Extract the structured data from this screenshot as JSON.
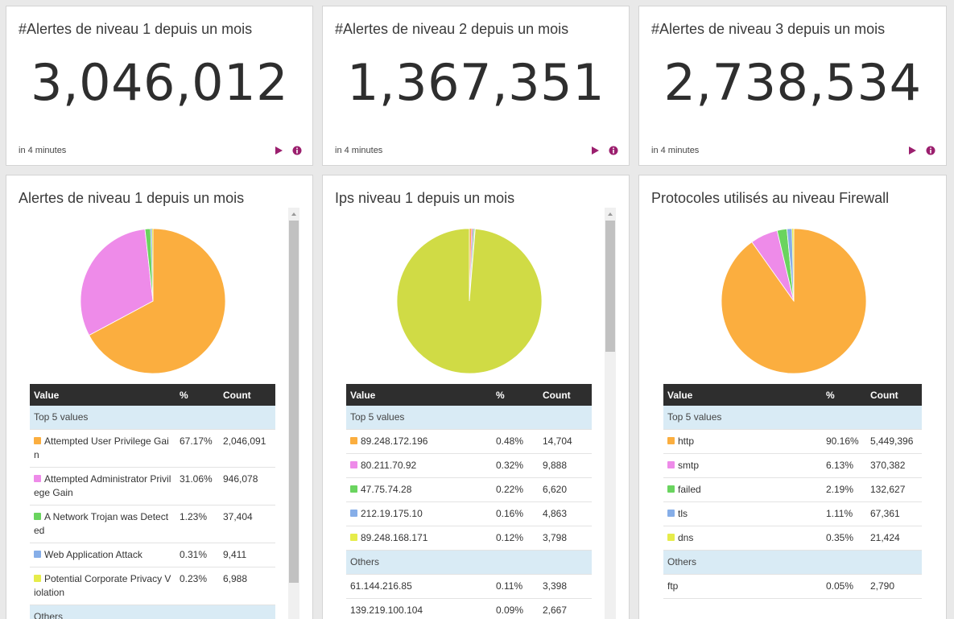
{
  "stat_cards": [
    {
      "title": "#Alertes de niveau 1 depuis un mois",
      "value": "3,046,012",
      "footer": "in 4 minutes"
    },
    {
      "title": "#Alertes de niveau 2 depuis un mois",
      "value": "1,367,351",
      "footer": "in 4 minutes"
    },
    {
      "title": "#Alertes de niveau 3 depuis un mois",
      "value": "2,738,534",
      "footer": "in 4 minutes"
    }
  ],
  "icons": {
    "play": "play-icon",
    "info": "info-icon"
  },
  "colors": {
    "accent": "#9b1f6e",
    "orange": "#fbae3f",
    "pink": "#ee8be9",
    "green": "#6ad45f",
    "blue": "#86aee8",
    "yellow": "#e6ec4a",
    "olive": "#d0db45"
  },
  "table_headers": {
    "value": "Value",
    "percent": "%",
    "count": "Count"
  },
  "groups": {
    "top": "Top 5 values",
    "others": "Others"
  },
  "panels": [
    {
      "title": "Alertes de niveau 1 depuis un mois",
      "top_rows": [
        {
          "value": "Attempted User Privilege Gain",
          "percent": "67.17%",
          "count": "2,046,091",
          "color": "#fbae3f"
        },
        {
          "value": "Attempted Administrator Privilege Gain",
          "percent": "31.06%",
          "count": "946,078",
          "color": "#ee8be9"
        },
        {
          "value": "A Network Trojan was Detected",
          "percent": "1.23%",
          "count": "37,404",
          "color": "#6ad45f"
        },
        {
          "value": "Web Application Attack",
          "percent": "0.31%",
          "count": "9,411",
          "color": "#86aee8"
        },
        {
          "value": "Potential Corporate Privacy Violation",
          "percent": "0.23%",
          "count": "6,988",
          "color": "#e6ec4a"
        }
      ],
      "other_rows": []
    },
    {
      "title": "Ips niveau 1 depuis un mois",
      "top_rows": [
        {
          "value": "89.248.172.196",
          "percent": "0.48%",
          "count": "14,704",
          "color": "#fbae3f"
        },
        {
          "value": "80.211.70.92",
          "percent": "0.32%",
          "count": "9,888",
          "color": "#ee8be9"
        },
        {
          "value": "47.75.74.28",
          "percent": "0.22%",
          "count": "6,620",
          "color": "#6ad45f"
        },
        {
          "value": "212.19.175.10",
          "percent": "0.16%",
          "count": "4,863",
          "color": "#86aee8"
        },
        {
          "value": "89.248.168.171",
          "percent": "0.12%",
          "count": "3,798",
          "color": "#e6ec4a"
        }
      ],
      "other_rows": [
        {
          "value": "61.144.216.85",
          "percent": "0.11%",
          "count": "3,398"
        },
        {
          "value": "139.219.100.104",
          "percent": "0.09%",
          "count": "2,667"
        }
      ]
    },
    {
      "title": "Protocoles utilisés au niveau Firewall",
      "top_rows": [
        {
          "value": "http",
          "percent": "90.16%",
          "count": "5,449,396",
          "color": "#fbae3f"
        },
        {
          "value": "smtp",
          "percent": "6.13%",
          "count": "370,382",
          "color": "#ee8be9"
        },
        {
          "value": "failed",
          "percent": "2.19%",
          "count": "132,627",
          "color": "#6ad45f"
        },
        {
          "value": "tls",
          "percent": "1.11%",
          "count": "67,361",
          "color": "#86aee8"
        },
        {
          "value": "dns",
          "percent": "0.35%",
          "count": "21,424",
          "color": "#e6ec4a"
        }
      ],
      "other_rows": [
        {
          "value": "ftp",
          "percent": "0.05%",
          "count": "2,790"
        }
      ]
    }
  ],
  "chart_data": [
    {
      "type": "pie",
      "labels": [
        "Attempted User Privilege Gain",
        "Attempted Administrator Privilege Gain",
        "A Network Trojan was Detected",
        "Web Application Attack",
        "Potential Corporate Privacy Violation"
      ],
      "values": [
        67.17,
        31.06,
        1.23,
        0.31,
        0.23
      ],
      "colors": [
        "#fbae3f",
        "#ee8be9",
        "#6ad45f",
        "#86aee8",
        "#e6ec4a"
      ]
    },
    {
      "type": "pie",
      "labels": [
        "89.248.172.196",
        "80.211.70.92",
        "47.75.74.28",
        "212.19.175.10",
        "89.248.168.171",
        "Others"
      ],
      "values": [
        0.48,
        0.32,
        0.22,
        0.16,
        0.12,
        98.7
      ],
      "colors": [
        "#fbae3f",
        "#ee8be9",
        "#6ad45f",
        "#86aee8",
        "#e6ec4a",
        "#d0db45"
      ]
    },
    {
      "type": "pie",
      "labels": [
        "http",
        "smtp",
        "failed",
        "tls",
        "dns",
        "ftp"
      ],
      "values": [
        90.16,
        6.13,
        2.19,
        1.11,
        0.35,
        0.05
      ],
      "colors": [
        "#fbae3f",
        "#ee8be9",
        "#6ad45f",
        "#86aee8",
        "#e6ec4a",
        "#ffd0a0"
      ]
    }
  ]
}
